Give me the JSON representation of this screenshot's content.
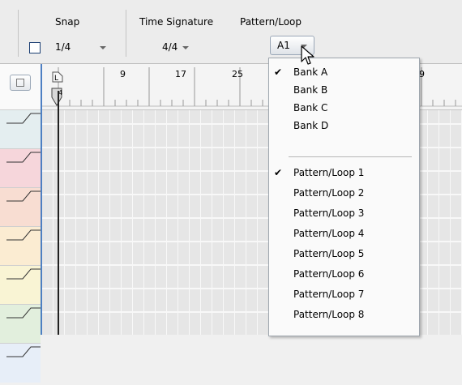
{
  "toolbar": {
    "snap_label": "Snap",
    "snap_value": "1/4",
    "time_signature_label": "Time Signature",
    "time_signature_value": "4/4",
    "pattern_loop_label": "Pattern/Loop",
    "pattern_loop_value": "A1"
  },
  "ruler": {
    "marker_left": "L",
    "marker_position": "4",
    "numbers": [
      "9",
      "17",
      "25",
      "9"
    ]
  },
  "menu": {
    "banks": [
      {
        "label": "Bank A",
        "checked": true
      },
      {
        "label": "Bank B",
        "checked": false
      },
      {
        "label": "Bank C",
        "checked": false
      },
      {
        "label": "Bank D",
        "checked": false
      }
    ],
    "patterns": [
      {
        "label": "Pattern/Loop 1",
        "checked": true
      },
      {
        "label": "Pattern/Loop 2",
        "checked": false
      },
      {
        "label": "Pattern/Loop 3",
        "checked": false
      },
      {
        "label": "Pattern/Loop 4",
        "checked": false
      },
      {
        "label": "Pattern/Loop 5",
        "checked": false
      },
      {
        "label": "Pattern/Loop 6",
        "checked": false
      },
      {
        "label": "Pattern/Loop 7",
        "checked": false
      },
      {
        "label": "Pattern/Loop 8",
        "checked": false
      }
    ],
    "check_glyph": "✔"
  },
  "tracks": {
    "colors": [
      "#e4eef0",
      "#f6d6db",
      "#f8ddd2",
      "#fbecd2",
      "#f9f4d4",
      "#e2efdd",
      "#e7eef8"
    ]
  }
}
